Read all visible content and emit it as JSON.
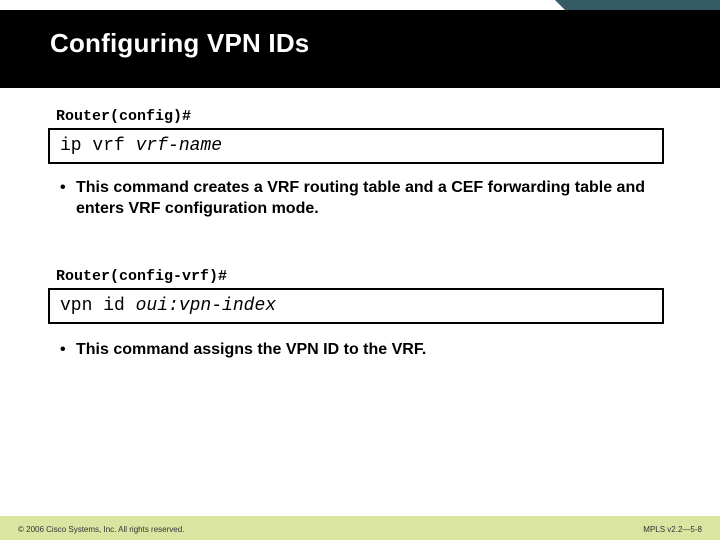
{
  "title": "Configuring VPN IDs",
  "block1": {
    "prompt": "Router(config)#",
    "cmd": "ip vrf ",
    "arg": "vrf-name",
    "bullet": "This command creates a VRF routing table and a CEF forwarding table and enters VRF configuration mode."
  },
  "block2": {
    "prompt": "Router(config-vrf)#",
    "cmd": "vpn id ",
    "arg": "oui:vpn-index",
    "bullet": "This command assigns the VPN ID to the VRF."
  },
  "footer": {
    "copyright": "© 2006 Cisco Systems, Inc. All rights reserved.",
    "ref": "MPLS v2.2—5-8"
  }
}
